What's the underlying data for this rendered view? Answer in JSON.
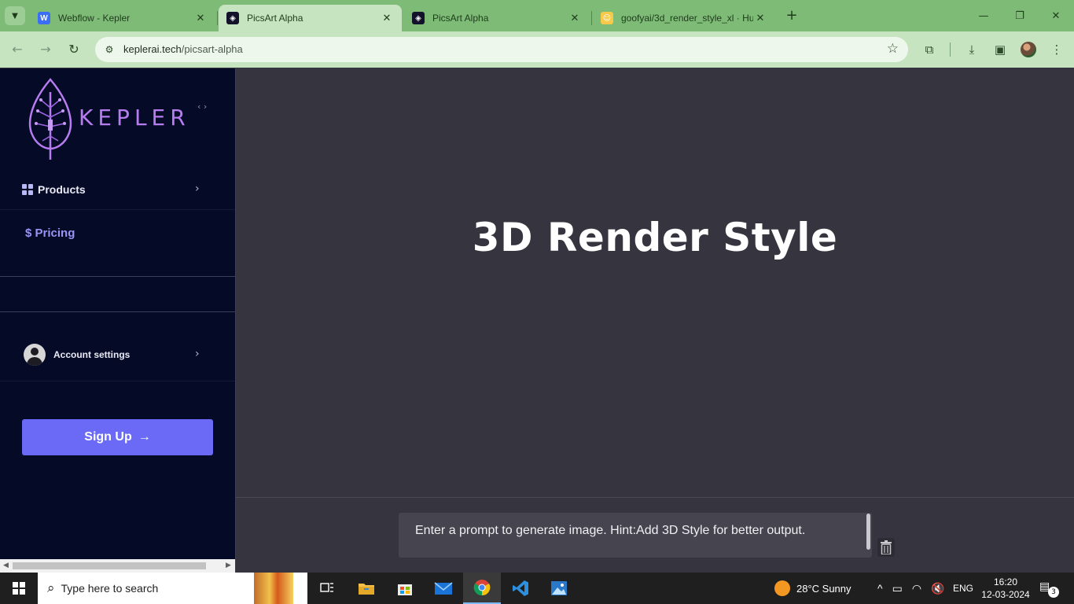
{
  "browser": {
    "tabs": [
      {
        "title": "Webflow - Kepler",
        "favicon": "webflow-icon",
        "active": false
      },
      {
        "title": "PicsArt Alpha",
        "favicon": "kepler-icon",
        "active": true
      },
      {
        "title": "PicsArt Alpha",
        "favicon": "kepler-icon",
        "active": false
      },
      {
        "title": "goofyai/3d_render_style_xl · Hu",
        "favicon": "huggingface-icon",
        "active": false
      }
    ],
    "url_host": "keplerai.tech",
    "url_path": "/picsart-alpha",
    "colors": {
      "tabstrip": "#7dbb76",
      "toolbar": "#c6e4c0"
    }
  },
  "sidebar": {
    "brand": "KEPLER",
    "products_label": "Products",
    "pricing_label": "$ Pricing",
    "account_label": "Account settings",
    "signup_label": "Sign Up",
    "colors": {
      "background": "#050a26",
      "brand": "#b67cf0",
      "signup": "#6a6af7"
    }
  },
  "main": {
    "heading": "3D Render Style",
    "prompt_text": "Enter a prompt to generate image. Hint:Add 3D Style for better output."
  },
  "taskbar": {
    "search_placeholder": "Type here to search",
    "weather": "28°C  Sunny",
    "language": "ENG",
    "time": "16:20",
    "date": "12-03-2024",
    "notification_count": "3"
  }
}
